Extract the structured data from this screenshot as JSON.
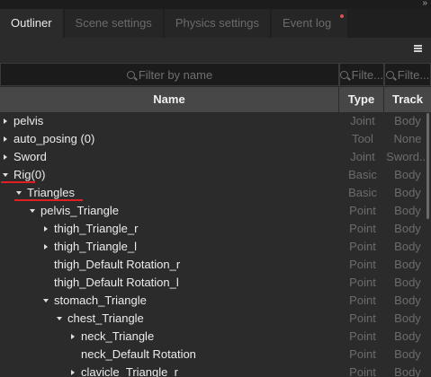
{
  "window": {
    "resize_glyph": "»"
  },
  "tabs": [
    {
      "label": "Outliner",
      "active": true
    },
    {
      "label": "Scene settings",
      "active": false
    },
    {
      "label": "Physics settings",
      "active": false
    },
    {
      "label": "Event log",
      "active": false,
      "has_dot": true
    }
  ],
  "toolbar": {
    "menu_icon": "hamburger-icon"
  },
  "filters": {
    "name_placeholder": "Filter by name",
    "type_placeholder": "Filte...",
    "track_placeholder": "Filte..."
  },
  "columns": {
    "name": "Name",
    "type": "Type",
    "track": "Track"
  },
  "rows": [
    {
      "label": "pelvis",
      "type": "Joint",
      "track": "Body",
      "depth": 0,
      "expander": "collapsed"
    },
    {
      "label": "auto_posing (0)",
      "type": "Tool",
      "track": "None",
      "depth": 0,
      "expander": "collapsed"
    },
    {
      "label": "Sword",
      "type": "Joint",
      "track": "Sword...",
      "depth": 0,
      "expander": "collapsed"
    },
    {
      "label": "Rig(0)",
      "type": "Basic",
      "track": "Body",
      "depth": 0,
      "expander": "expanded",
      "underlined": true
    },
    {
      "label": "Triangles",
      "type": "Basic",
      "track": "Body",
      "depth": 1,
      "expander": "expanded",
      "underlined": true
    },
    {
      "label": "pelvis_Triangle",
      "type": "Point",
      "track": "Body",
      "depth": 2,
      "expander": "expanded"
    },
    {
      "label": "thigh_Triangle_r",
      "type": "Point",
      "track": "Body",
      "depth": 3,
      "expander": "collapsed"
    },
    {
      "label": "thigh_Triangle_l",
      "type": "Point",
      "track": "Body",
      "depth": 3,
      "expander": "collapsed"
    },
    {
      "label": "thigh_Default Rotation_r",
      "type": "Point",
      "track": "Body",
      "depth": 3,
      "expander": "none"
    },
    {
      "label": "thigh_Default Rotation_l",
      "type": "Point",
      "track": "Body",
      "depth": 3,
      "expander": "none"
    },
    {
      "label": "stomach_Triangle",
      "type": "Point",
      "track": "Body",
      "depth": 3,
      "expander": "expanded"
    },
    {
      "label": "chest_Triangle",
      "type": "Point",
      "track": "Body",
      "depth": 4,
      "expander": "expanded"
    },
    {
      "label": "neck_Triangle",
      "type": "Point",
      "track": "Body",
      "depth": 5,
      "expander": "collapsed"
    },
    {
      "label": "neck_Default Rotation",
      "type": "Point",
      "track": "Body",
      "depth": 5,
      "expander": "none"
    },
    {
      "label": "clavicle_Triangle_r",
      "type": "Point",
      "track": "Body",
      "depth": 5,
      "expander": "collapsed"
    }
  ]
}
